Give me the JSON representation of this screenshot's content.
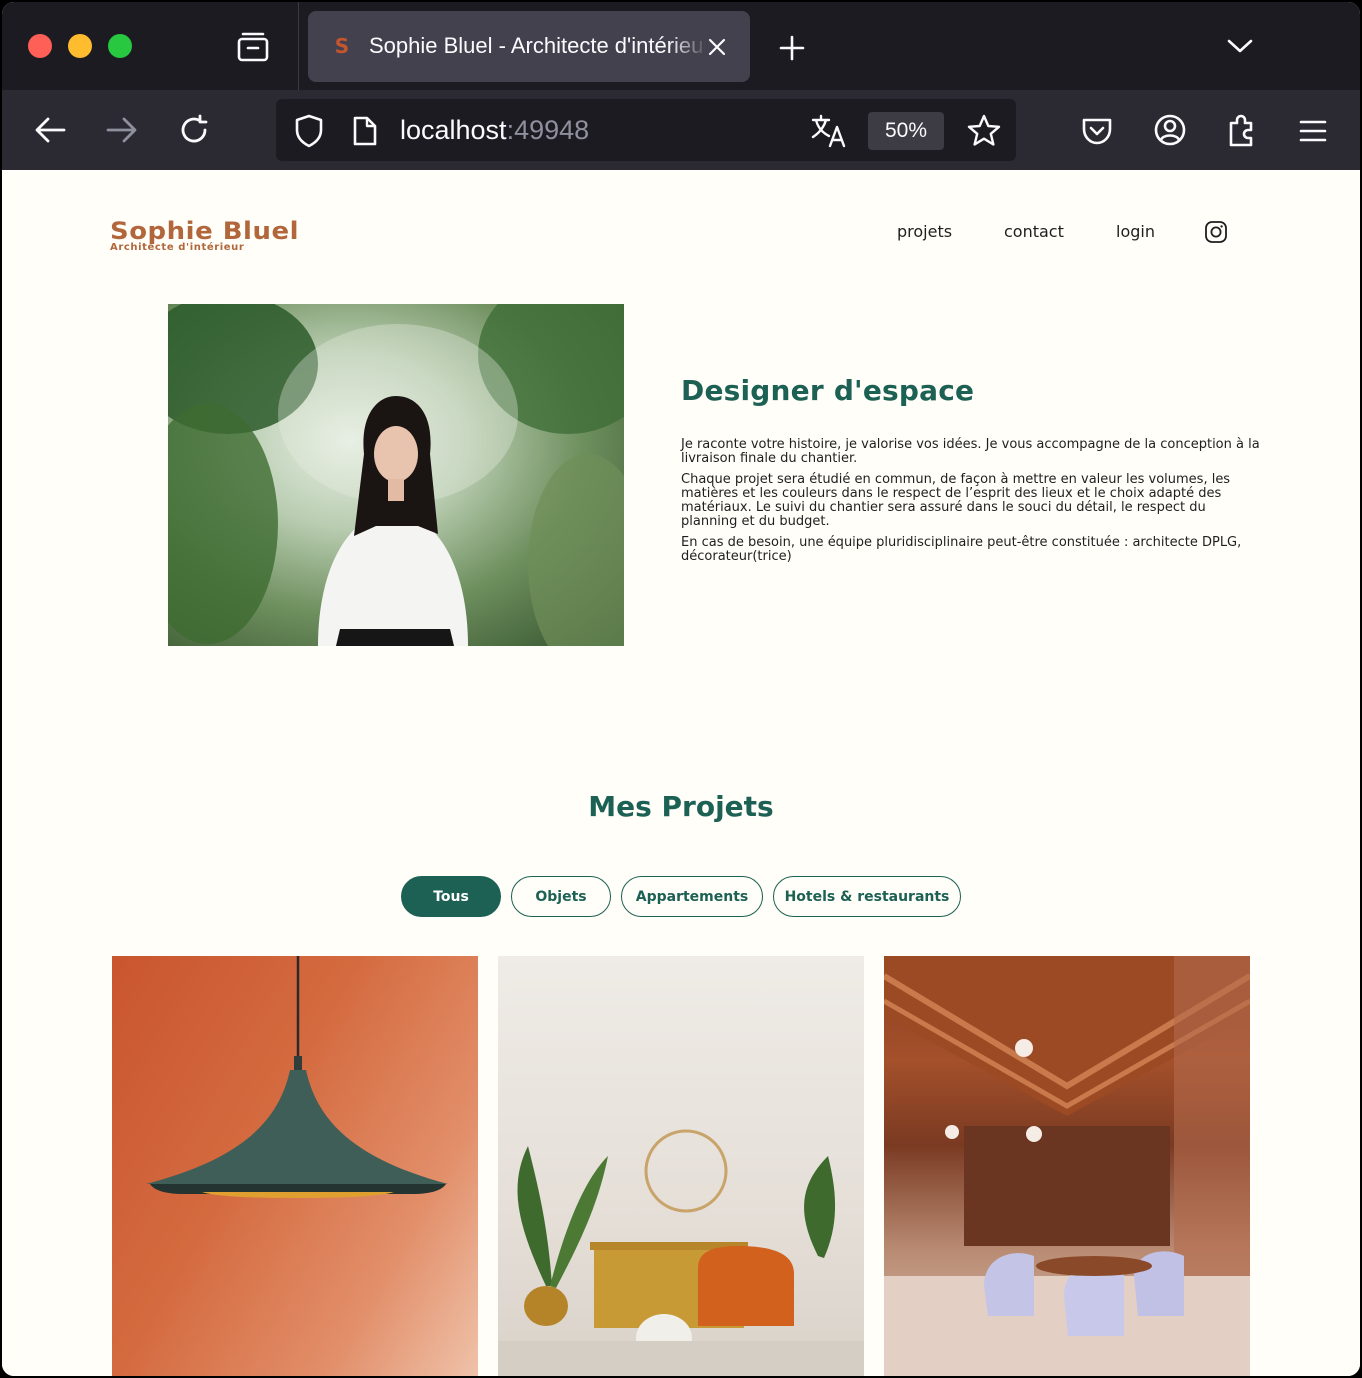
{
  "browser": {
    "tab": {
      "favicon": "S",
      "title": "Sophie Bluel - Architecte d'intérieur"
    },
    "url": {
      "host": "localhost",
      "port": ":49948"
    },
    "zoom": "50%",
    "icons": {
      "close": "close-icon",
      "back": "back-arrow-icon",
      "forward": "forward-arrow-icon",
      "reload": "reload-icon",
      "shield": "shield-icon",
      "page": "page-icon",
      "translate": "translate-icon",
      "star": "star-icon",
      "pocket": "pocket-icon",
      "account": "account-icon",
      "extensions": "extensions-icon",
      "menu": "menu-icon"
    },
    "colors": {
      "tabbar": "#1c1b22",
      "toolbar": "#2b2a33",
      "active_tab": "#42414d"
    }
  },
  "site": {
    "logo": {
      "name": "Sophie Bluel",
      "subtitle": "Architecte d'intérieur"
    },
    "nav": {
      "projets": "projets",
      "contact": "contact",
      "login": "login"
    },
    "intro": {
      "title": "Designer d'espace",
      "paragraphs": [
        "Je raconte votre histoire, je valorise vos idées. Je vous accompagne de la conception à la livraison finale du chantier.",
        "Chaque projet sera étudié en commun, de façon à mettre en valeur les volumes, les matières et les couleurs dans le respect de l’esprit des lieux et le choix adapté des matériaux. Le suivi du chantier sera assuré dans le souci du détail, le respect du planning et du budget.",
        "En cas de besoin, une équipe pluridisciplinaire peut-être constituée : architecte DPLG, décorateur(trice)"
      ]
    },
    "portfolio": {
      "title": "Mes Projets",
      "filters": [
        {
          "label": "Tous",
          "active": true
        },
        {
          "label": "Objets",
          "active": false
        },
        {
          "label": "Appartements",
          "active": false
        },
        {
          "label": "Hotels & restaurants",
          "active": false
        }
      ]
    },
    "colors": {
      "brand_green": "#1d6154",
      "logo_brown": "#b1663c",
      "background": "#fffef8"
    }
  }
}
